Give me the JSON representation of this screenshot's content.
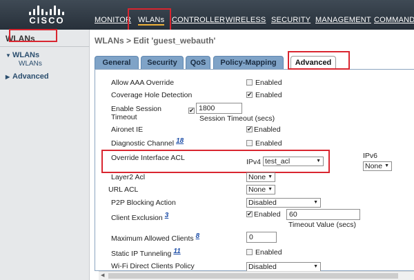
{
  "logo": {
    "text": "CISCO",
    "icon": "cisco-bars-logo"
  },
  "top_nav": [
    {
      "label": "MONITOR"
    },
    {
      "label": "WLANs"
    },
    {
      "label": "CONTROLLER"
    },
    {
      "label": "WIRELESS"
    },
    {
      "label": "SECURITY"
    },
    {
      "label": "MANAGEMENT"
    },
    {
      "label": "COMMANDS"
    }
  ],
  "sidebar": {
    "title": "WLANs",
    "items": [
      {
        "label": "WLANs",
        "expanded": true,
        "children": [
          {
            "label": "WLANs"
          }
        ]
      },
      {
        "label": "Advanced",
        "expanded": false
      }
    ]
  },
  "breadcrumb": "WLANs > Edit  'guest_webauth'",
  "tabs": [
    {
      "label": "General"
    },
    {
      "label": "Security"
    },
    {
      "label": "QoS"
    },
    {
      "label": "Policy-Mapping"
    },
    {
      "label": "Advanced",
      "active": true
    }
  ],
  "form": {
    "allow_aaa_override": {
      "label": "Allow AAA Override",
      "checked": false,
      "text": "Enabled"
    },
    "coverage_hole": {
      "label": "Coverage Hole Detection",
      "checked": true,
      "text": "Enabled"
    },
    "session_timeout": {
      "label_line1": "Enable Session",
      "label_line2": "Timeout",
      "checked": true,
      "value": "1800",
      "caption": "Session Timeout (secs)"
    },
    "aironet_ie": {
      "label": "Aironet IE",
      "checked": true,
      "text": "Enabled"
    },
    "diagnostic_channel": {
      "label": "Diagnostic Channel",
      "footnote": "18",
      "checked": false,
      "text": "Enabled"
    },
    "override_acl": {
      "label": "Override Interface ACL",
      "ipv4_label": "IPv4",
      "ipv4_value": "test_acl",
      "ipv6_label": "IPv6",
      "ipv6_value": "None"
    },
    "layer2_acl": {
      "label": "Layer2 Acl",
      "value": "None"
    },
    "url_acl": {
      "label": "URL ACL",
      "value": "None"
    },
    "p2p_blocking": {
      "label": "P2P Blocking Action",
      "value": "Disabled"
    },
    "client_exclusion": {
      "label": "Client Exclusion",
      "footnote": "3",
      "checked": true,
      "text": "Enabled",
      "value": "60",
      "caption": "Timeout Value (secs)"
    },
    "max_clients": {
      "label": "Maximum Allowed Clients",
      "footnote": "8",
      "value": "0"
    },
    "static_ip_tunneling": {
      "label": "Static IP Tunneling",
      "footnote": "11",
      "checked": false,
      "text": "Enabled"
    },
    "wifi_direct": {
      "label": "Wi-Fi Direct Clients Policy",
      "value": "Disabled"
    }
  },
  "colors": {
    "highlight": "#d9252f",
    "tab_bg": "#7fa3c7",
    "topbar": "#2f3944",
    "active_underline": "#f0b33a"
  }
}
